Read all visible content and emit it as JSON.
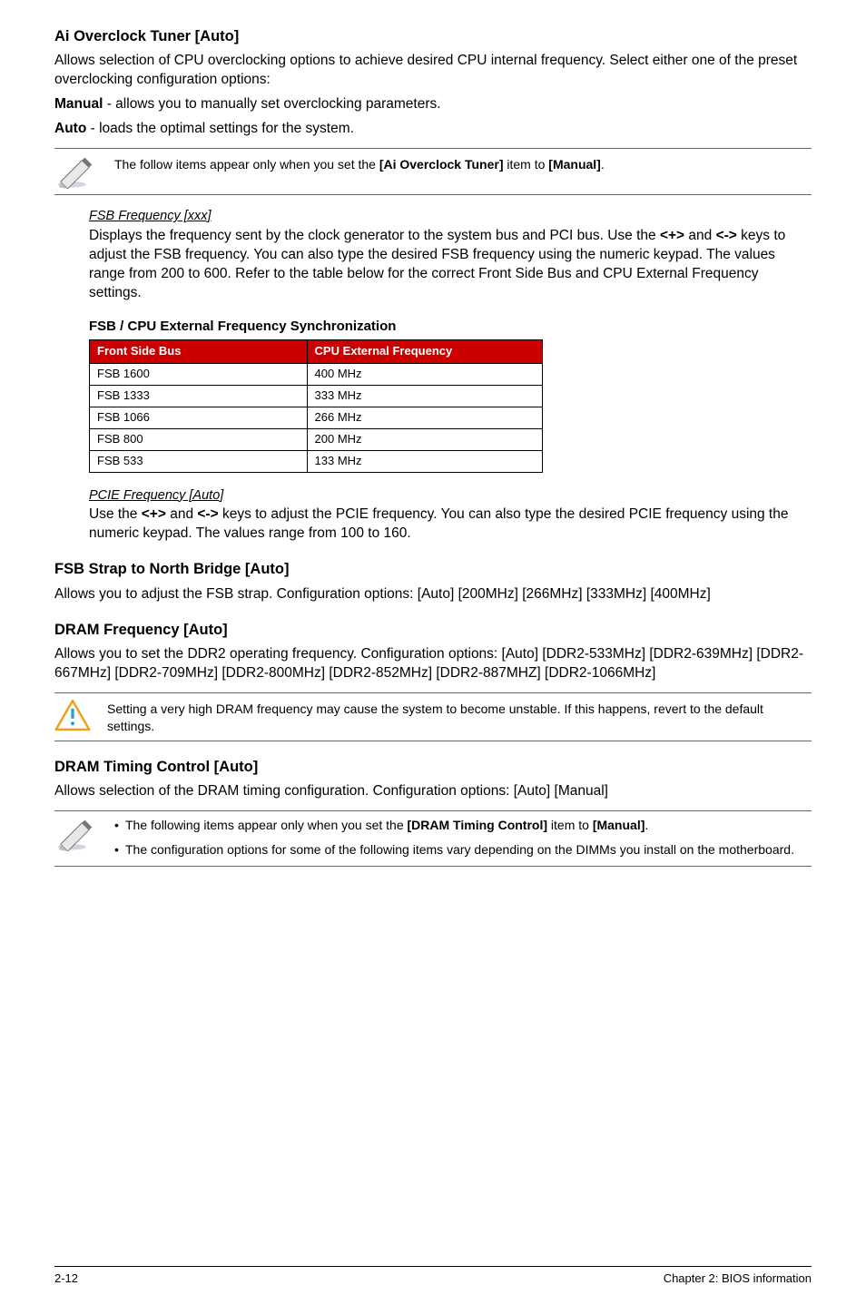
{
  "s1": {
    "heading": "Ai Overclock Tuner [Auto]",
    "intro": "Allows selection of CPU overclocking options to achieve desired CPU internal frequency. Select either one of the preset overclocking configuration options:",
    "manual_label": "Manual",
    "manual_desc": " - allows you to manually set overclocking parameters.",
    "auto_label": "Auto",
    "auto_desc": " - loads the optimal settings for the system.",
    "note_prefix": "The follow items appear only when you set the ",
    "note_bold1": "[Ai Overclock Tuner]",
    "note_mid": " item to ",
    "note_bold2": "[Manual]",
    "note_suffix": "."
  },
  "fsbfreq": {
    "heading": "FSB Frequency [xxx]",
    "p_a": "Displays the frequency sent by the clock generator to the system bus and PCI bus. Use the ",
    "p_b": "<+>",
    "p_c": " and ",
    "p_d": "<->",
    "p_e": " keys to adjust the FSB frequency. You can also type the desired FSB frequency using the numeric keypad. The values range from 200 to 600. Refer to the table below for the correct Front Side Bus and CPU External Frequency settings."
  },
  "table": {
    "title": "FSB / CPU External Frequency Synchronization",
    "col1": "Front Side Bus",
    "col2": "CPU External Frequency",
    "rows": [
      {
        "a": "FSB 1600",
        "b": "400 MHz"
      },
      {
        "a": "FSB 1333",
        "b": "333 MHz"
      },
      {
        "a": "FSB 1066",
        "b": "266 MHz"
      },
      {
        "a": "FSB 800",
        "b": "200 MHz"
      },
      {
        "a": "FSB 533",
        "b": "133 MHz"
      }
    ]
  },
  "pcie": {
    "heading": "PCIE Frequency [Auto]",
    "p_a": "Use the ",
    "p_b": "<+>",
    "p_c": " and ",
    "p_d": "<->",
    "p_e": " keys to adjust the PCIE frequency. You can also type the desired PCIE frequency using the numeric keypad. The values range from 100 to 160."
  },
  "s2": {
    "heading": "FSB Strap to North Bridge [Auto]",
    "para": "Allows you to adjust the FSB strap. Configuration options: [Auto] [200MHz] [266MHz] [333MHz] [400MHz]"
  },
  "s3": {
    "heading": "DRAM Frequency [Auto]",
    "para": "Allows you to set the DDR2 operating frequency. Configuration options: [Auto] [DDR2-533MHz] [DDR2-639MHz] [DDR2-667MHz] [DDR2-709MHz] [DDR2-800MHz] [DDR2-852MHz] [DDR2-887MHZ] [DDR2-1066MHz]",
    "warn": "Setting a very high DRAM frequency may cause the system to become unstable. If this happens, revert to the default settings."
  },
  "s4": {
    "heading": "DRAM Timing Control [Auto]",
    "para": "Allows selection of the DRAM timing configuration. Configuration options: [Auto] [Manual]",
    "li1_a": "The following items appear only when you set the ",
    "li1_b": "[DRAM Timing Control]",
    "li1_c": " item to ",
    "li1_d": "[Manual]",
    "li1_e": ".",
    "li2": "The configuration options for some of the following items vary depending on the DIMMs you install on the motherboard."
  },
  "footer": {
    "left": "2-12",
    "right": "Chapter 2: BIOS information"
  }
}
